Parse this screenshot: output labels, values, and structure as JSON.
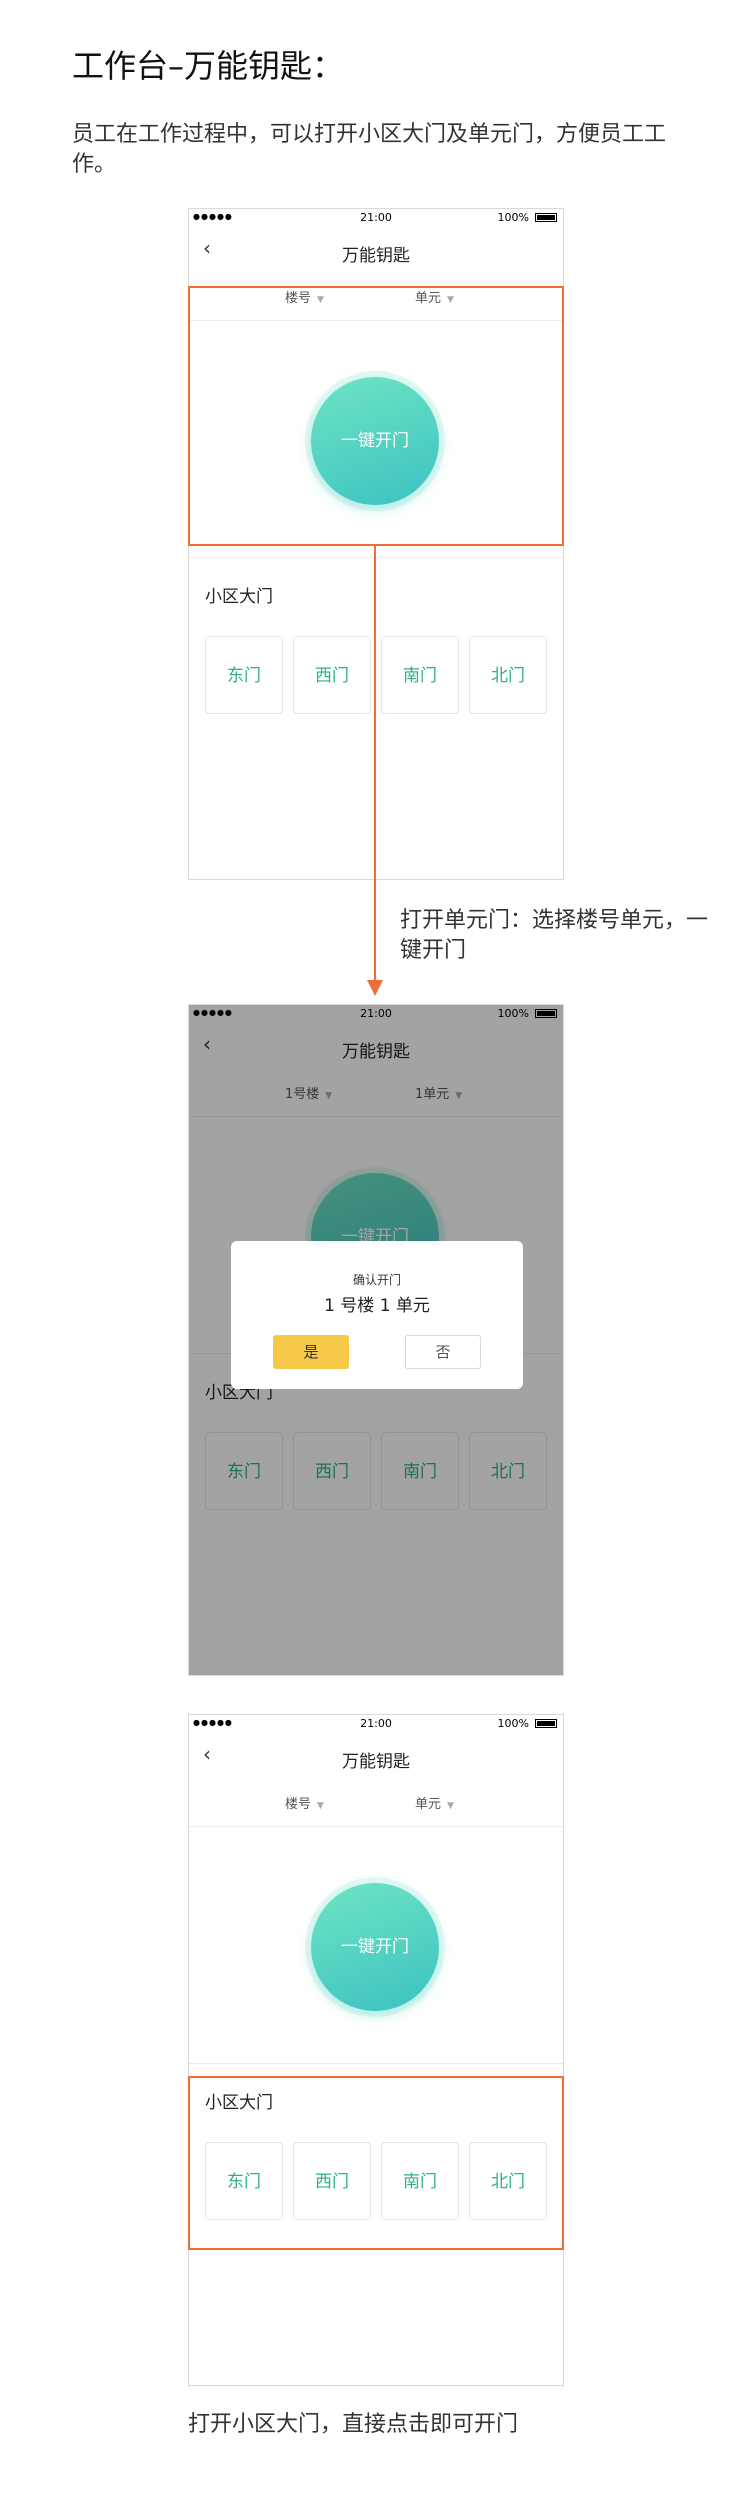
{
  "page": {
    "title": "工作台–万能钥匙：",
    "description": "员工在工作过程中，可以打开小区大门及单元门，方便员工工作。",
    "note_unit_door": "打开单元门：选择楼号单元，一键开门",
    "note_gate": "打开小区大门，直接点击即可开门"
  },
  "colors": {
    "highlight": "#ee6e3a",
    "button_gradient_start": "#6ee4c3",
    "button_gradient_end": "#3cc2c2",
    "gate_text": "#2db08a",
    "confirm_button": "#f7c94b"
  },
  "icons": {
    "back": "chevron-left-icon",
    "battery": "battery-icon",
    "signal": "signal-wifi-icon",
    "dropdown": "caret-down-icon"
  },
  "screens": [
    {
      "status": {
        "signal": "●●●●● ",
        "time": "21:00",
        "battery": "100%"
      },
      "nav_title": "万能钥匙",
      "selector": {
        "building": "楼号",
        "unit": "单元"
      },
      "open_button": "一键开门",
      "gates": {
        "title": "小区大门",
        "items": [
          "东门",
          "西门",
          "南门",
          "北门"
        ]
      }
    },
    {
      "status": {
        "signal": "●●●●● ",
        "time": "21:00",
        "battery": "100%"
      },
      "nav_title": "万能钥匙",
      "selector": {
        "building": "1号楼",
        "unit": "1单元"
      },
      "open_button": "一键开门",
      "gates": {
        "title": "小区大门",
        "items": [
          "东门",
          "西门",
          "南门",
          "北门"
        ]
      },
      "dialog": {
        "title": "确认开门",
        "subtitle": "1 号楼 1 单元",
        "yes": "是",
        "no": "否"
      }
    },
    {
      "status": {
        "signal": "●●●●● ",
        "time": "21:00",
        "battery": "100%"
      },
      "nav_title": "万能钥匙",
      "selector": {
        "building": "楼号",
        "unit": "单元"
      },
      "open_button": "一键开门",
      "gates": {
        "title": "小区大门",
        "items": [
          "东门",
          "西门",
          "南门",
          "北门"
        ]
      }
    }
  ]
}
